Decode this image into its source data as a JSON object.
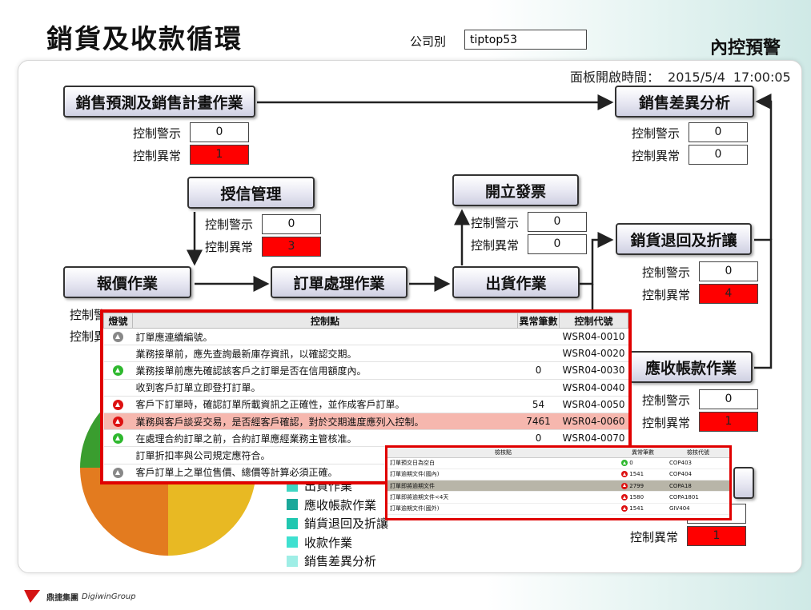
{
  "title": "銷貨及收款循環",
  "company": {
    "label": "公司別",
    "value": "tiptop53"
  },
  "alert_title": "內控預警",
  "open_time": {
    "label": "面板開啟時間：",
    "date": "2015/5/4",
    "time": "17:00:05"
  },
  "labels": {
    "warn": "控制警示",
    "abn": "控制異常"
  },
  "processes": {
    "forecast": {
      "name": "銷售預測及銷售計畫作業",
      "warn": "0",
      "abn": "1"
    },
    "variance": {
      "name": "銷售差異分析",
      "warn": "0",
      "abn": "0"
    },
    "credit": {
      "name": "授信管理",
      "warn": "0",
      "abn": "3"
    },
    "invoice": {
      "name": "開立發票",
      "warn": "0",
      "abn": "0"
    },
    "returns": {
      "name": "銷貨退回及折讓",
      "warn": "0",
      "abn": "4"
    },
    "quote": {
      "name": "報價作業"
    },
    "order": {
      "name": "訂單處理作業"
    },
    "shipping": {
      "name": "出貨作業"
    },
    "receivable": {
      "name": "應收帳款作業",
      "warn": "0",
      "abn": "1"
    },
    "collection": {
      "abn": "1"
    }
  },
  "legend": [
    {
      "label": "出貨作業",
      "color": "#3fd6c3"
    },
    {
      "label": "應收帳款作業",
      "color": "#1aa89a"
    },
    {
      "label": "銷貨退回及折讓",
      "color": "#20c7b0"
    },
    {
      "label": "收款作業",
      "color": "#3fe0d0"
    },
    {
      "label": "銷售差異分析",
      "color": "#9feee6"
    }
  ],
  "pie_colors": [
    "#3a9d2f",
    "#e37b1f",
    "#e8b923",
    "#d63b1a"
  ],
  "popup1": {
    "headers": [
      "燈號",
      "控制點",
      "異常筆數",
      "控制代號"
    ],
    "rows": [
      {
        "light": "gray",
        "point": "訂單應連續編號。",
        "count": "",
        "code": "WSR04-0010"
      },
      {
        "light": "",
        "point": "業務接單前，應先查詢最新庫存資訊，以確認交期。",
        "count": "",
        "code": "WSR04-0020"
      },
      {
        "light": "green",
        "point": "業務接單前應先確認該客戶之訂單是否在信用額度內。",
        "count": "0",
        "code": "WSR04-0030"
      },
      {
        "light": "",
        "point": "收到客戶訂單立即登打訂單。",
        "count": "",
        "code": "WSR04-0040"
      },
      {
        "light": "red",
        "point": "客戶下訂單時，確認訂單所載資訊之正確性，並作成客戶訂單。",
        "count": "54",
        "code": "WSR04-0050"
      },
      {
        "light": "red",
        "point": "業務與客戶談妥交易，是否經客戶確認，對於交期進度應列入控制。",
        "count": "7461",
        "code": "WSR04-0060"
      },
      {
        "light": "green",
        "point": "在處理合約訂單之前，合約訂單應經業務主管核准。",
        "count": "0",
        "code": "WSR04-0070"
      },
      {
        "light": "",
        "point": "訂單折扣率與公司規定應符合。",
        "count": "",
        "code": ""
      },
      {
        "light": "gray",
        "point": "客戶訂單上之單位售價、總價等計算必須正確。",
        "count": "",
        "code": ""
      }
    ]
  },
  "popup2": {
    "headers": [
      "檢核點",
      "異常筆數",
      "檢核代號"
    ],
    "rows": [
      {
        "point": "訂單預交日為空白",
        "light": "green",
        "count": "0",
        "code": "COP403"
      },
      {
        "point": "訂單逾期文件(國內)",
        "light": "red",
        "count": "1541",
        "code": "COP404"
      },
      {
        "point": "訂單即將逾期文件",
        "light": "red",
        "count": "2799",
        "code": "COPA18"
      },
      {
        "point": "訂單即將逾期文件<4天",
        "light": "red",
        "count": "1580",
        "code": "COPA1801"
      },
      {
        "point": "訂單逾期文件(國外)",
        "light": "red",
        "count": "1541",
        "code": "GIV404"
      }
    ]
  },
  "logo": {
    "cn": "鼎捷集團",
    "en": "DigiwinGroup"
  }
}
